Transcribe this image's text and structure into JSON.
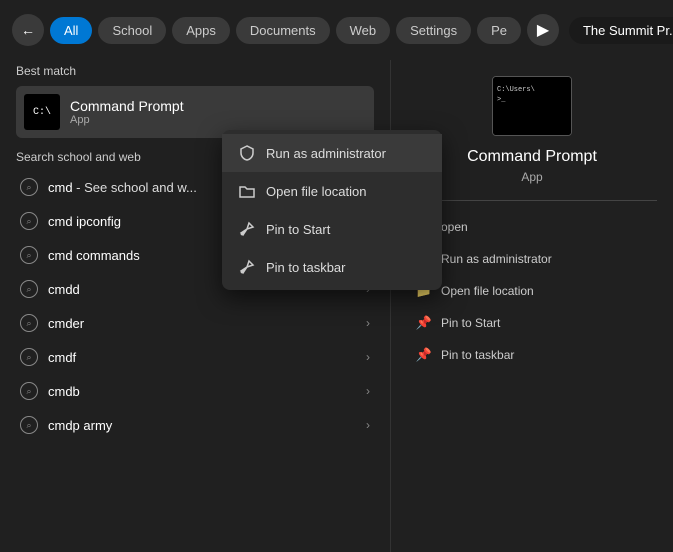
{
  "nav": {
    "back_label": "←",
    "tabs": [
      {
        "label": "All",
        "active": true
      },
      {
        "label": "School",
        "active": false
      },
      {
        "label": "Apps",
        "active": false
      },
      {
        "label": "Documents",
        "active": false
      },
      {
        "label": "Web",
        "active": false
      },
      {
        "label": "Settings",
        "active": false
      },
      {
        "label": "Pe",
        "active": false
      }
    ],
    "more_label": "▶",
    "summit_label": "The Summit Pr..."
  },
  "best_match": {
    "section_title": "Best match",
    "item": {
      "name": "Command Prompt",
      "type": "App"
    }
  },
  "search_section": {
    "title": "Search school and web",
    "items": [
      {
        "text_prefix": "cmd",
        "text_suffix": " - See school and w...",
        "has_arrow": false
      },
      {
        "text_prefix": "cmd ipconfig",
        "text_suffix": "",
        "has_arrow": false
      },
      {
        "text_prefix": "cmd commands",
        "text_suffix": "",
        "has_arrow": true
      },
      {
        "text_prefix": "cmdd",
        "text_suffix": "",
        "has_arrow": true
      },
      {
        "text_prefix": "cmder",
        "text_suffix": "",
        "has_arrow": true
      },
      {
        "text_prefix": "cmdf",
        "text_suffix": "",
        "has_arrow": true
      },
      {
        "text_prefix": "cmdb",
        "text_suffix": "",
        "has_arrow": true
      },
      {
        "text_prefix": "cmdp army",
        "text_suffix": "",
        "has_arrow": true
      }
    ]
  },
  "context_menu": {
    "items": [
      {
        "label": "Run as administrator",
        "icon": "shield"
      },
      {
        "label": "Open file location",
        "icon": "folder"
      },
      {
        "label": "Pin to Start",
        "icon": "pin"
      },
      {
        "label": "Pin to taskbar",
        "icon": "pin"
      }
    ]
  },
  "right_panel": {
    "title": "Command Prompt",
    "type": "App",
    "actions": [
      {
        "label": "open",
        "icon": "arrow"
      },
      {
        "label": "Run as administrator",
        "icon": "shield"
      },
      {
        "label": "Open file location",
        "icon": "folder"
      },
      {
        "label": "Pin to Start",
        "icon": "pin"
      },
      {
        "label": "Pin to taskbar",
        "icon": "pin"
      }
    ]
  }
}
